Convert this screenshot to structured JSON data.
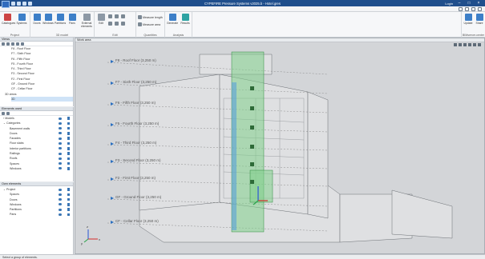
{
  "app": {
    "title": "CYPEFIRE Pressure Systems v2025.b - Hotel.gres",
    "login": "Login"
  },
  "ribbon": {
    "groups": [
      {
        "label": "Project",
        "buttons": [
          "Catalogues",
          "Systems"
        ]
      },
      {
        "label": "3D model",
        "buttons": [
          "Doors",
          "Windows",
          "Partitions",
          "Pans",
          "External elements"
        ]
      },
      {
        "label": "Edit",
        "buttons": [
          "Edit"
        ]
      },
      {
        "label": "Quantities",
        "buttons": [
          "Measure length",
          "Measure area"
        ]
      },
      {
        "label": "Analysis",
        "buttons": [
          "Generate",
          "Results"
        ]
      },
      {
        "label": "BIMserver.center",
        "buttons": [
          "Update",
          "Share"
        ]
      }
    ]
  },
  "views_panel": {
    "title": "Views",
    "items": [
      "F8 - Roof Floor",
      "F7 - Sixth Floor",
      "F6 - Fifth Floor",
      "F5 - Fourth Floor",
      "F4 - Third Floor",
      "F3 - Second Floor",
      "F2 - First Floor",
      "GF - Ground Floor",
      "CF - Cellar Floor",
      "3D views",
      "3D"
    ],
    "selected": "3D"
  },
  "elements_panel": {
    "title": "Elements used",
    "items": [
      "Models",
      "Categories",
      "Basement walls",
      "Doors",
      "Facades",
      "Floor slabs",
      "Interior partitions",
      "Railings",
      "Roofs",
      "Spaces",
      "Windows"
    ]
  },
  "own_panel": {
    "title": "Own elements",
    "items": [
      "Project",
      "Spaces",
      "Doors",
      "Windows",
      "Partitions",
      "Pans"
    ]
  },
  "workarea": {
    "title": "Work area",
    "floor_labels": [
      "F8 - Roof Floor (3,250 m)",
      "F7 - Sixth Floor (3,250 m)",
      "F6 - Fifth Floor (3,250 m)",
      "F5 - Fourth Floor (3,250 m)",
      "F4 - Third Floor (3,250 m)",
      "F3 - Second Floor (3,250 m)",
      "F2 - First Floor (3,250 m)",
      "GF - Ground Floor (3,250 m)",
      "CF - Cellar Floor (3,250 m)"
    ],
    "axes": {
      "x": "x",
      "y": "y",
      "z": "z"
    }
  },
  "status": {
    "text": "Select a group of elements."
  }
}
